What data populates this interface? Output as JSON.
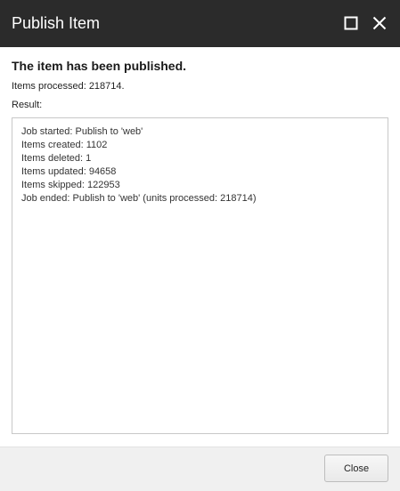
{
  "window": {
    "title": "Publish Item",
    "maximize_icon": "maximize-icon",
    "close_icon": "close-icon",
    "titlebar_color": "#2b2b2b"
  },
  "main": {
    "heading": "The item has been published.",
    "items_processed": "Items processed: 218714.",
    "result_label": "Result:",
    "result_lines": [
      "Job started: Publish to 'web'",
      "Items created: 1102",
      "Items deleted: 1",
      "Items updated: 94658",
      "Items skipped: 122953",
      "Job ended: Publish to 'web' (units processed: 218714)"
    ]
  },
  "footer": {
    "close_label": "Close"
  }
}
